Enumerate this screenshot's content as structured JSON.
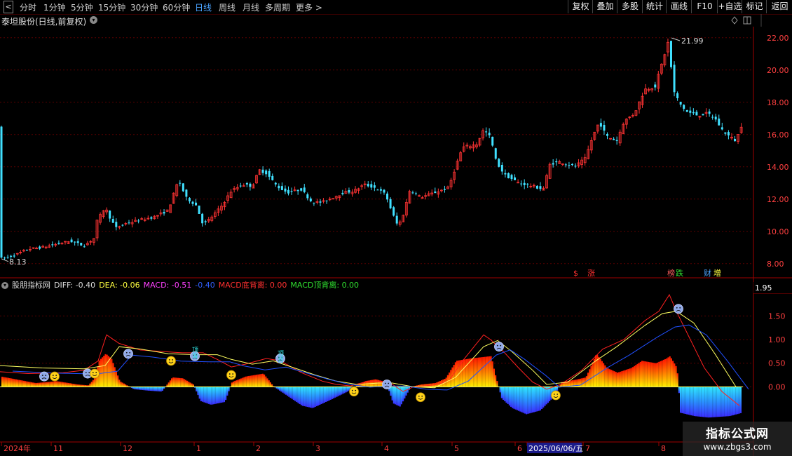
{
  "toolbar": {
    "back_arrow": "<",
    "periods": [
      {
        "label": "分时",
        "active": false
      },
      {
        "label": "1分钟",
        "active": false
      },
      {
        "label": "5分钟",
        "active": false
      },
      {
        "label": "15分钟",
        "active": false
      },
      {
        "label": "30分钟",
        "active": false
      },
      {
        "label": "60分钟",
        "active": false
      },
      {
        "label": "日线",
        "active": true
      },
      {
        "label": "周线",
        "active": false
      },
      {
        "label": "月线",
        "active": false
      },
      {
        "label": "多周期",
        "active": false
      },
      {
        "label": "更多 >",
        "active": false
      }
    ],
    "tools": [
      "复权",
      "叠加",
      "多股",
      "统计",
      "画线",
      "F10",
      "+自选",
      "标记",
      "返回"
    ]
  },
  "stock_title": "泰坦股份(日线,前复权)",
  "price_axis": {
    "ticks": [
      "22.00",
      "20.00",
      "18.00",
      "16.00",
      "14.00",
      "12.00",
      "10.00",
      "8.00"
    ]
  },
  "price_high_label": "21.99",
  "price_low_label": "8.13",
  "event_markers": [
    {
      "text": "$",
      "color": "#ff3030"
    },
    {
      "text": "涨",
      "color": "#ff3030"
    },
    {
      "text": "榜",
      "color": "#ff6060"
    },
    {
      "text": "跌",
      "color": "#30e030"
    },
    {
      "text": "财",
      "color": "#4aa3ff"
    },
    {
      "text": "增",
      "color": "#ffff40"
    }
  ],
  "indicator": {
    "name": "股朋指标网",
    "diff": "DIFF: -0.40",
    "dea": "DEA: -0.06",
    "macd": "MACD: -0.51",
    "extra": "-0.40",
    "bottom_div": "MACD底背离: 0.00",
    "top_div": "MACD顶背离: 0.00",
    "axis_ticks": [
      "1.50",
      "1.00",
      "0.50",
      "0.00"
    ],
    "current_value": "1.95",
    "top_label_text": "顶背"
  },
  "date_axis": [
    "2024年",
    "11",
    "12",
    "1",
    "2",
    "3",
    "4",
    "5",
    "6",
    "2025/06/06/五",
    "7",
    "8"
  ],
  "watermark": {
    "title": "指标公式网",
    "url": "www.zbgs3.com"
  },
  "colors": {
    "up": "#ff3333",
    "down": "#40e0ff",
    "diff": "#ff2020",
    "dea": "#ffff60",
    "macd_line": "#2050ff",
    "grid": "#5a0000"
  },
  "chart_data": [
    {
      "type": "candlestick",
      "x_range": [
        "2024-10",
        "2025-08"
      ],
      "ylim": [
        7.6,
        22.6
      ],
      "close_path": [
        [
          0,
          8.3
        ],
        [
          20,
          8.5
        ],
        [
          40,
          8.9
        ],
        [
          60,
          9.0
        ],
        [
          80,
          9.2
        ],
        [
          100,
          9.4
        ],
        [
          120,
          9.1
        ],
        [
          135,
          9.6
        ],
        [
          138,
          10.6
        ],
        [
          150,
          11.5
        ],
        [
          155,
          11.0
        ],
        [
          165,
          10.2
        ],
        [
          180,
          10.5
        ],
        [
          200,
          10.7
        ],
        [
          220,
          10.9
        ],
        [
          240,
          11.3
        ],
        [
          250,
          12.6
        ],
        [
          255,
          13.2
        ],
        [
          265,
          12.1
        ],
        [
          280,
          11.6
        ],
        [
          290,
          10.4
        ],
        [
          300,
          10.8
        ],
        [
          315,
          11.5
        ],
        [
          330,
          12.5
        ],
        [
          345,
          12.9
        ],
        [
          360,
          12.8
        ],
        [
          370,
          13.8
        ],
        [
          380,
          13.6
        ],
        [
          395,
          12.8
        ],
        [
          410,
          12.4
        ],
        [
          430,
          12.6
        ],
        [
          445,
          11.8
        ],
        [
          460,
          11.8
        ],
        [
          475,
          12.1
        ],
        [
          490,
          12.4
        ],
        [
          505,
          12.5
        ],
        [
          520,
          12.9
        ],
        [
          535,
          12.7
        ],
        [
          550,
          12.3
        ],
        [
          560,
          11.1
        ],
        [
          568,
          10.3
        ],
        [
          575,
          11.0
        ],
        [
          585,
          12.6
        ],
        [
          600,
          12.1
        ],
        [
          620,
          12.4
        ],
        [
          640,
          12.7
        ],
        [
          650,
          14.0
        ],
        [
          660,
          15.2
        ],
        [
          680,
          15.4
        ],
        [
          690,
          16.3
        ],
        [
          700,
          15.8
        ],
        [
          708,
          14.3
        ],
        [
          720,
          13.5
        ],
        [
          740,
          13.0
        ],
        [
          760,
          12.8
        ],
        [
          775,
          12.6
        ],
        [
          785,
          14.2
        ],
        [
          800,
          14.3
        ],
        [
          820,
          14.0
        ],
        [
          835,
          14.5
        ],
        [
          845,
          15.8
        ],
        [
          855,
          16.8
        ],
        [
          865,
          15.9
        ],
        [
          880,
          15.6
        ],
        [
          890,
          16.8
        ],
        [
          905,
          17.3
        ],
        [
          920,
          18.8
        ],
        [
          935,
          19.0
        ],
        [
          945,
          20.5
        ],
        [
          955,
          21.99
        ],
        [
          958,
          19.8
        ],
        [
          962,
          18.6
        ],
        [
          970,
          17.9
        ],
        [
          980,
          17.4
        ],
        [
          995,
          17.2
        ],
        [
          1010,
          17.3
        ],
        [
          1020,
          17.0
        ],
        [
          1030,
          16.3
        ],
        [
          1040,
          15.9
        ],
        [
          1050,
          15.6
        ],
        [
          1058,
          16.6
        ]
      ]
    },
    {
      "type": "macd",
      "ylim": [
        -0.9,
        2.1
      ],
      "diff": [
        [
          0,
          0.32
        ],
        [
          40,
          0.28
        ],
        [
          90,
          0.3
        ],
        [
          120,
          0.35
        ],
        [
          140,
          0.55
        ],
        [
          152,
          1.1
        ],
        [
          170,
          0.92
        ],
        [
          200,
          0.78
        ],
        [
          230,
          0.75
        ],
        [
          260,
          0.72
        ],
        [
          290,
          0.72
        ],
        [
          310,
          0.58
        ],
        [
          330,
          0.42
        ],
        [
          350,
          0.48
        ],
        [
          380,
          0.6
        ],
        [
          400,
          0.55
        ],
        [
          430,
          0.3
        ],
        [
          460,
          0.12
        ],
        [
          480,
          0.05
        ],
        [
          500,
          0.02
        ],
        [
          520,
          0.1
        ],
        [
          540,
          0.12
        ],
        [
          560,
          0.05
        ],
        [
          575,
          -0.1
        ],
        [
          590,
          0.0
        ],
        [
          620,
          0.04
        ],
        [
          640,
          0.12
        ],
        [
          660,
          0.55
        ],
        [
          690,
          1.1
        ],
        [
          700,
          1.0
        ],
        [
          720,
          0.72
        ],
        [
          740,
          0.4
        ],
        [
          760,
          0.1
        ],
        [
          780,
          -0.05
        ],
        [
          800,
          0.05
        ],
        [
          830,
          0.35
        ],
        [
          860,
          0.8
        ],
        [
          890,
          1.0
        ],
        [
          920,
          1.4
        ],
        [
          940,
          1.6
        ],
        [
          955,
          1.95
        ],
        [
          965,
          1.6
        ],
        [
          985,
          1.0
        ],
        [
          1005,
          0.4
        ],
        [
          1030,
          -0.1
        ],
        [
          1055,
          -0.4
        ]
      ],
      "dea": [
        [
          0,
          0.45
        ],
        [
          60,
          0.4
        ],
        [
          120,
          0.38
        ],
        [
          150,
          0.45
        ],
        [
          170,
          0.85
        ],
        [
          200,
          0.8
        ],
        [
          240,
          0.7
        ],
        [
          280,
          0.68
        ],
        [
          310,
          0.68
        ],
        [
          330,
          0.58
        ],
        [
          360,
          0.48
        ],
        [
          390,
          0.55
        ],
        [
          420,
          0.4
        ],
        [
          450,
          0.25
        ],
        [
          480,
          0.12
        ],
        [
          510,
          0.05
        ],
        [
          540,
          0.08
        ],
        [
          560,
          0.08
        ],
        [
          590,
          0.0
        ],
        [
          620,
          -0.02
        ],
        [
          650,
          0.2
        ],
        [
          690,
          0.85
        ],
        [
          710,
          0.98
        ],
        [
          730,
          0.75
        ],
        [
          760,
          0.35
        ],
        [
          780,
          0.05
        ],
        [
          810,
          0.1
        ],
        [
          850,
          0.55
        ],
        [
          880,
          0.85
        ],
        [
          920,
          1.3
        ],
        [
          945,
          1.55
        ],
        [
          965,
          1.6
        ],
        [
          990,
          1.35
        ],
        [
          1020,
          0.7
        ],
        [
          1050,
          0.0
        ]
      ],
      "macd_hist": [
        [
          0,
          0.22
        ],
        [
          50,
          0.08
        ],
        [
          80,
          0.12
        ],
        [
          110,
          0.05
        ],
        [
          125,
          0.03
        ],
        [
          135,
          0.2
        ],
        [
          140,
          0.55
        ],
        [
          150,
          0.7
        ],
        [
          158,
          0.6
        ],
        [
          170,
          0.12
        ],
        [
          190,
          -0.05
        ],
        [
          210,
          -0.08
        ],
        [
          230,
          -0.1
        ],
        [
          245,
          0.2
        ],
        [
          260,
          0.18
        ],
        [
          275,
          0.05
        ],
        [
          285,
          -0.3
        ],
        [
          300,
          -0.38
        ],
        [
          320,
          -0.32
        ],
        [
          330,
          0.1
        ],
        [
          350,
          0.22
        ],
        [
          375,
          0.28
        ],
        [
          390,
          0.0
        ],
        [
          410,
          -0.2
        ],
        [
          430,
          -0.4
        ],
        [
          445,
          -0.45
        ],
        [
          470,
          -0.28
        ],
        [
          495,
          -0.1
        ],
        [
          505,
          0.0
        ],
        [
          520,
          0.12
        ],
        [
          535,
          0.16
        ],
        [
          550,
          0.1
        ],
        [
          560,
          -0.35
        ],
        [
          570,
          -0.42
        ],
        [
          585,
          0.0
        ],
        [
          600,
          0.05
        ],
        [
          620,
          0.08
        ],
        [
          635,
          0.18
        ],
        [
          650,
          0.55
        ],
        [
          670,
          0.6
        ],
        [
          700,
          0.65
        ],
        [
          705,
          0.3
        ],
        [
          715,
          -0.25
        ],
        [
          730,
          -0.45
        ],
        [
          750,
          -0.58
        ],
        [
          770,
          -0.5
        ],
        [
          790,
          -0.2
        ],
        [
          800,
          0.1
        ],
        [
          820,
          0.15
        ],
        [
          835,
          0.2
        ],
        [
          850,
          0.7
        ],
        [
          865,
          0.4
        ],
        [
          880,
          0.3
        ],
        [
          900,
          0.4
        ],
        [
          915,
          0.55
        ],
        [
          935,
          0.5
        ],
        [
          950,
          0.6
        ],
        [
          955,
          0.65
        ],
        [
          965,
          0.4
        ],
        [
          970,
          -0.55
        ],
        [
          990,
          -0.62
        ],
        [
          1010,
          -0.65
        ],
        [
          1040,
          -0.62
        ],
        [
          1058,
          -0.55
        ]
      ],
      "sad_faces": [
        [
          63,
          0.22
        ],
        [
          125,
          0.28
        ],
        [
          183,
          0.7
        ],
        [
          278,
          0.65
        ],
        [
          400,
          0.6
        ],
        [
          552,
          0.05
        ],
        [
          712,
          0.85
        ],
        [
          968,
          1.65
        ]
      ],
      "smile_faces": [
        [
          78,
          0.22
        ],
        [
          135,
          0.28
        ],
        [
          244,
          0.55
        ],
        [
          330,
          0.25
        ],
        [
          505,
          -0.1
        ],
        [
          600,
          -0.22
        ],
        [
          793,
          -0.18
        ]
      ],
      "top_labels": [
        [
          283,
          0.85
        ],
        [
          405,
          0.78
        ]
      ]
    }
  ]
}
